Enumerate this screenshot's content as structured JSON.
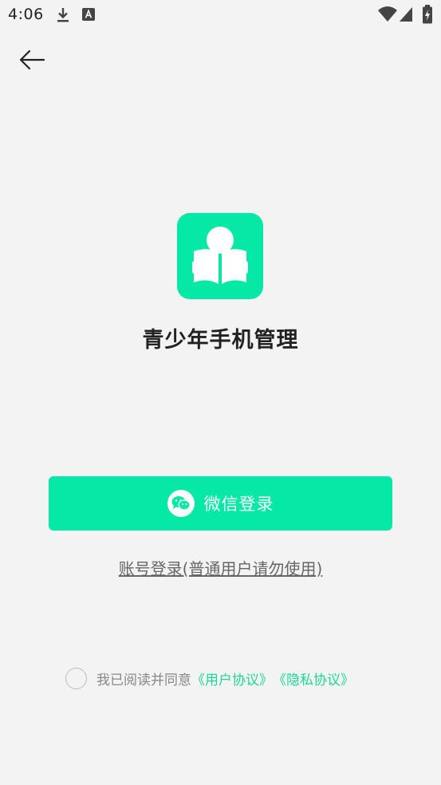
{
  "status_bar": {
    "time": "4:06"
  },
  "app": {
    "title": "青少年手机管理",
    "brand_color": "#05e8a6"
  },
  "login": {
    "wechat_label": "微信登录",
    "account_label": "账号登录(普通用户请勿使用)"
  },
  "agreement": {
    "prefix": "我已阅读并同意",
    "user_agreement": "《用户协议》",
    "privacy_policy": "《隐私协议》",
    "checked": false
  }
}
